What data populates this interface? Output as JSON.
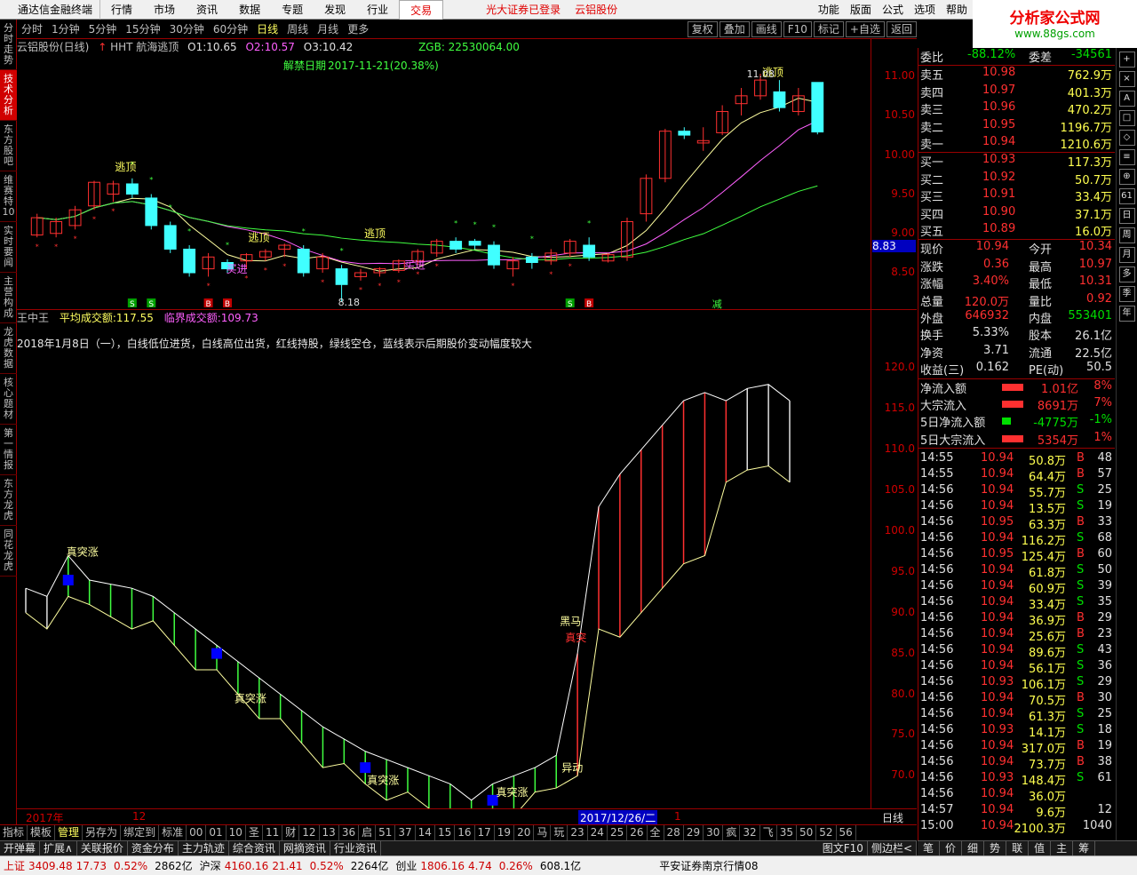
{
  "menubar": {
    "app_title": "通达信金融终端",
    "items": [
      "行情",
      "市场",
      "资讯",
      "数据",
      "专题",
      "发现",
      "行业"
    ],
    "active": "交易",
    "promo1": "光大证券已登录",
    "promo2": "云铝股份",
    "right": [
      "功能",
      "版面",
      "公式",
      "选项",
      "帮助"
    ]
  },
  "brand": {
    "name": "分析家公式网",
    "url": "www.88gs.com"
  },
  "leftnav": [
    "分时走势",
    "技术分析",
    "东方股吧",
    "维赛特10",
    "实时要闻",
    "主营构成",
    "龙虎数据",
    "核心题材",
    "第一情报",
    "东方龙虎",
    "同花龙虎"
  ],
  "periodbar": {
    "periods": [
      "分时",
      "1分钟",
      "5分钟",
      "15分钟",
      "30分钟",
      "60分钟",
      "日线",
      "周线",
      "月线",
      "更多"
    ],
    "active": "日线",
    "tools": [
      "复权",
      "叠加",
      "画线",
      "F10",
      "标记",
      "+自选",
      "返回"
    ]
  },
  "kinfo": {
    "stock": "云铝股份(日线)",
    "indicator": "HHT 航海逃顶",
    "o1_label": "O1:",
    "o1": "10.65",
    "o2_label": "O2:",
    "o2": "10.57",
    "o3_label": "O3:",
    "o3": "10.42",
    "zgb": "ZGB: 22530064.00",
    "unlock_label": "解禁日期",
    "unlock_value": "2017-11-21(20.38%)",
    "hi_label": "11.08",
    "lo_label": "8.18"
  },
  "ind2": {
    "name": "王中王",
    "avg_label": "平均成交额:",
    "avg": "117.55",
    "crit_label": "临界成交额:",
    "crit": "109.73"
  },
  "note": "2018年1月8日（一），白线低位进货，白线高位出货，红线持股，绿线空仓，蓝线表示后期股价变动幅度较大",
  "yaxis1": [
    "11.00",
    "10.50",
    "10.00",
    "9.50",
    "9.00",
    "8.50"
  ],
  "price_tag": "8.83",
  "yaxis2": [
    "120.0",
    "115.0",
    "110.0",
    "105.0",
    "100.0",
    "95.0",
    "90.0",
    "85.0",
    "80.0",
    "75.0",
    "70.0"
  ],
  "annot": {
    "escape": "逃顶",
    "buy": "买进",
    "jump": "真突涨",
    "black_horse": "黑马",
    "breakout": "真突",
    "move": "异动",
    "reduce": "减"
  },
  "xaxis": {
    "y2017": "2017年",
    "m12": "12",
    "date": "2017/12/26/二",
    "m1": "1",
    "period": "日线"
  },
  "bottomtabs": [
    "指标",
    "模板",
    "管理",
    "另存为",
    "绑定到",
    "标准",
    "00",
    "01",
    "10",
    "圣",
    "11",
    "财",
    "12",
    "13",
    "36",
    "启",
    "51",
    "37",
    "14",
    "15",
    "16",
    "17",
    "19",
    "20",
    "马",
    "玩",
    "23",
    "24",
    "25",
    "26",
    "全",
    "28",
    "29",
    "30",
    "疯",
    "32",
    "飞",
    "35",
    "50",
    "52",
    "56"
  ],
  "bottom_active": "管理",
  "funcbar": [
    "开弹幕",
    "扩展∧",
    "关联报价",
    "资金分布",
    "主力轨迹",
    "综合资讯",
    "网摘资讯",
    "行业资讯"
  ],
  "funcbar_right": [
    "图文F10",
    "侧边栏<"
  ],
  "orderbook": {
    "wb": {
      "label": "委比",
      "v1": "-88.12%",
      "label2": "委差",
      "v2": "-34561"
    },
    "sell": [
      [
        "卖五",
        "10.98",
        "762.9万"
      ],
      [
        "卖四",
        "10.97",
        "401.3万"
      ],
      [
        "卖三",
        "10.96",
        "470.2万"
      ],
      [
        "卖二",
        "10.95",
        "1196.7万"
      ],
      [
        "卖一",
        "10.94",
        "1210.6万"
      ]
    ],
    "buy": [
      [
        "买一",
        "10.93",
        "117.3万"
      ],
      [
        "买二",
        "10.92",
        "50.7万"
      ],
      [
        "买三",
        "10.91",
        "33.4万"
      ],
      [
        "买四",
        "10.90",
        "37.1万"
      ],
      [
        "买五",
        "10.89",
        "16.0万"
      ]
    ],
    "stats": [
      [
        "现价",
        "10.94",
        "今开",
        "10.34"
      ],
      [
        "涨跌",
        "0.36",
        "最高",
        "10.97"
      ],
      [
        "涨幅",
        "3.40%",
        "最低",
        "10.31"
      ],
      [
        "总量",
        "120.0万",
        "量比",
        "0.92"
      ],
      [
        "外盘",
        "646932",
        "内盘",
        "553401"
      ],
      [
        "换手",
        "5.33%",
        "股本",
        "26.1亿"
      ],
      [
        "净资",
        "3.71",
        "流通",
        "22.5亿"
      ],
      [
        "收益(三)",
        "0.162",
        "PE(动)",
        "50.5"
      ]
    ],
    "flows": [
      [
        "净流入额",
        "1.01亿",
        "8%"
      ],
      [
        "大宗流入",
        "8691万",
        "7%"
      ],
      [
        "5日净流入额",
        "-4775万",
        "-1%"
      ],
      [
        "5日大宗流入",
        "5354万",
        "1%"
      ]
    ]
  },
  "ticks": [
    [
      "14:55",
      "10.94",
      "50.8万",
      "B",
      "48"
    ],
    [
      "14:55",
      "10.94",
      "64.4万",
      "B",
      "57"
    ],
    [
      "14:56",
      "10.94",
      "55.7万",
      "S",
      "25"
    ],
    [
      "14:56",
      "10.94",
      "13.5万",
      "S",
      "19"
    ],
    [
      "14:56",
      "10.95",
      "63.3万",
      "B",
      "33"
    ],
    [
      "14:56",
      "10.94",
      "116.2万",
      "S",
      "68"
    ],
    [
      "14:56",
      "10.95",
      "125.4万",
      "B",
      "60"
    ],
    [
      "14:56",
      "10.94",
      "61.8万",
      "S",
      "50"
    ],
    [
      "14:56",
      "10.94",
      "60.9万",
      "S",
      "39"
    ],
    [
      "14:56",
      "10.94",
      "33.4万",
      "S",
      "35"
    ],
    [
      "14:56",
      "10.94",
      "36.9万",
      "B",
      "29"
    ],
    [
      "14:56",
      "10.94",
      "25.6万",
      "B",
      "23"
    ],
    [
      "14:56",
      "10.94",
      "89.6万",
      "S",
      "43"
    ],
    [
      "14:56",
      "10.94",
      "56.1万",
      "S",
      "36"
    ],
    [
      "14:56",
      "10.93",
      "106.1万",
      "S",
      "29"
    ],
    [
      "14:56",
      "10.94",
      "70.5万",
      "B",
      "30"
    ],
    [
      "14:56",
      "10.94",
      "61.3万",
      "S",
      "25"
    ],
    [
      "14:56",
      "10.93",
      "14.1万",
      "S",
      "18"
    ],
    [
      "14:56",
      "10.94",
      "317.0万",
      "B",
      "19"
    ],
    [
      "14:56",
      "10.94",
      "73.7万",
      "B",
      "38"
    ],
    [
      "14:56",
      "10.93",
      "148.4万",
      "S",
      "61"
    ],
    [
      "14:56",
      "10.94",
      "36.0万",
      "",
      ""
    ],
    [
      "14:57",
      "10.94",
      "9.6万",
      "",
      "12"
    ],
    [
      "15:00",
      "10.94",
      "2100.3万",
      "",
      "1040"
    ]
  ],
  "rbtabs": [
    "笔",
    "价",
    "细",
    "势",
    "联",
    "值",
    "主",
    "筹"
  ],
  "tools": [
    "+",
    "×",
    "A",
    "□",
    "◇",
    "≡",
    "⊕",
    "61",
    "日",
    "周",
    "月",
    "多",
    "季",
    "年"
  ],
  "statusbar": {
    "sh_label": "上证",
    "sh": "3409.48",
    "sh_ch": "17.73",
    "sh_pct": "0.52%",
    "sh_amt": "2862亿",
    "sz_label": "沪深",
    "sz": "4160.16",
    "sz_ch": "21.41",
    "sz_pct": "0.52%",
    "sz_amt": "2264亿",
    "cy_label": "创业",
    "cy": "1806.16",
    "cy_ch": "4.74",
    "cy_pct": "0.26%",
    "cy_amt": "608.1亿",
    "broker": "平安证券南京行情08"
  },
  "chart_data": [
    {
      "type": "candlestick",
      "title": "云铝股份(日线)",
      "candles": [
        [
          9.03,
          9.25,
          9.0,
          9.3
        ],
        [
          9.05,
          9.2,
          9.0,
          9.25
        ],
        [
          9.15,
          9.35,
          9.1,
          9.4
        ],
        [
          9.4,
          9.7,
          9.35,
          9.72
        ],
        [
          9.55,
          9.68,
          9.45,
          9.72
        ],
        [
          9.68,
          9.55,
          9.5,
          9.75
        ],
        [
          9.5,
          9.15,
          9.1,
          9.55
        ],
        [
          9.15,
          8.85,
          8.8,
          9.2
        ],
        [
          8.85,
          8.55,
          8.5,
          8.9
        ],
        [
          8.6,
          8.75,
          8.5,
          8.8
        ],
        [
          8.68,
          8.6,
          8.55,
          8.72
        ],
        [
          8.7,
          8.78,
          8.6,
          8.8
        ],
        [
          8.75,
          8.82,
          8.7,
          8.85
        ],
        [
          8.85,
          8.9,
          8.75,
          8.92
        ],
        [
          8.85,
          8.55,
          8.5,
          8.9
        ],
        [
          8.6,
          8.75,
          8.55,
          8.8
        ],
        [
          8.6,
          8.4,
          8.18,
          8.65
        ],
        [
          8.5,
          8.55,
          8.45,
          8.6
        ],
        [
          8.55,
          8.6,
          8.5,
          8.62
        ],
        [
          8.58,
          8.7,
          8.55,
          8.72
        ],
        [
          8.7,
          8.82,
          8.65,
          8.85
        ],
        [
          8.8,
          8.95,
          8.75,
          8.98
        ],
        [
          8.95,
          8.85,
          8.8,
          9.0
        ],
        [
          8.95,
          8.9,
          8.85,
          8.98
        ],
        [
          8.9,
          8.65,
          8.6,
          8.95
        ],
        [
          8.6,
          8.7,
          8.5,
          8.75
        ],
        [
          8.75,
          8.68,
          8.6,
          8.8
        ],
        [
          8.7,
          8.8,
          8.65,
          8.85
        ],
        [
          8.8,
          8.95,
          8.75,
          8.98
        ],
        [
          8.9,
          8.75,
          8.7,
          9.0
        ],
        [
          8.7,
          8.78,
          8.68,
          8.8
        ],
        [
          8.75,
          9.2,
          8.7,
          9.25
        ],
        [
          9.3,
          9.75,
          9.2,
          9.8
        ],
        [
          9.75,
          10.35,
          9.7,
          10.38
        ],
        [
          10.35,
          10.3,
          10.25,
          10.4
        ],
        [
          10.2,
          10.23,
          10.1,
          10.4
        ],
        [
          10.33,
          10.6,
          10.3,
          10.68
        ],
        [
          10.7,
          10.8,
          10.55,
          10.9
        ],
        [
          10.8,
          11.0,
          10.75,
          11.08
        ],
        [
          10.85,
          10.65,
          10.6,
          11.0
        ],
        [
          10.6,
          10.8,
          10.55,
          10.9
        ],
        [
          10.97,
          10.34,
          10.31,
          10.97
        ]
      ],
      "ylim": [
        8.2,
        11.25
      ]
    },
    {
      "type": "line",
      "title": "王中王",
      "ylim": [
        66,
        122
      ],
      "white": [
        93,
        92,
        97,
        94,
        93.5,
        93,
        92,
        90,
        88,
        86,
        84,
        82,
        80,
        78,
        76,
        74.5,
        73,
        72,
        71,
        70,
        69,
        67,
        69,
        70,
        71,
        72.5,
        85,
        103,
        107,
        110,
        113,
        116,
        117,
        116,
        117.5,
        118,
        116
      ]
    }
  ]
}
